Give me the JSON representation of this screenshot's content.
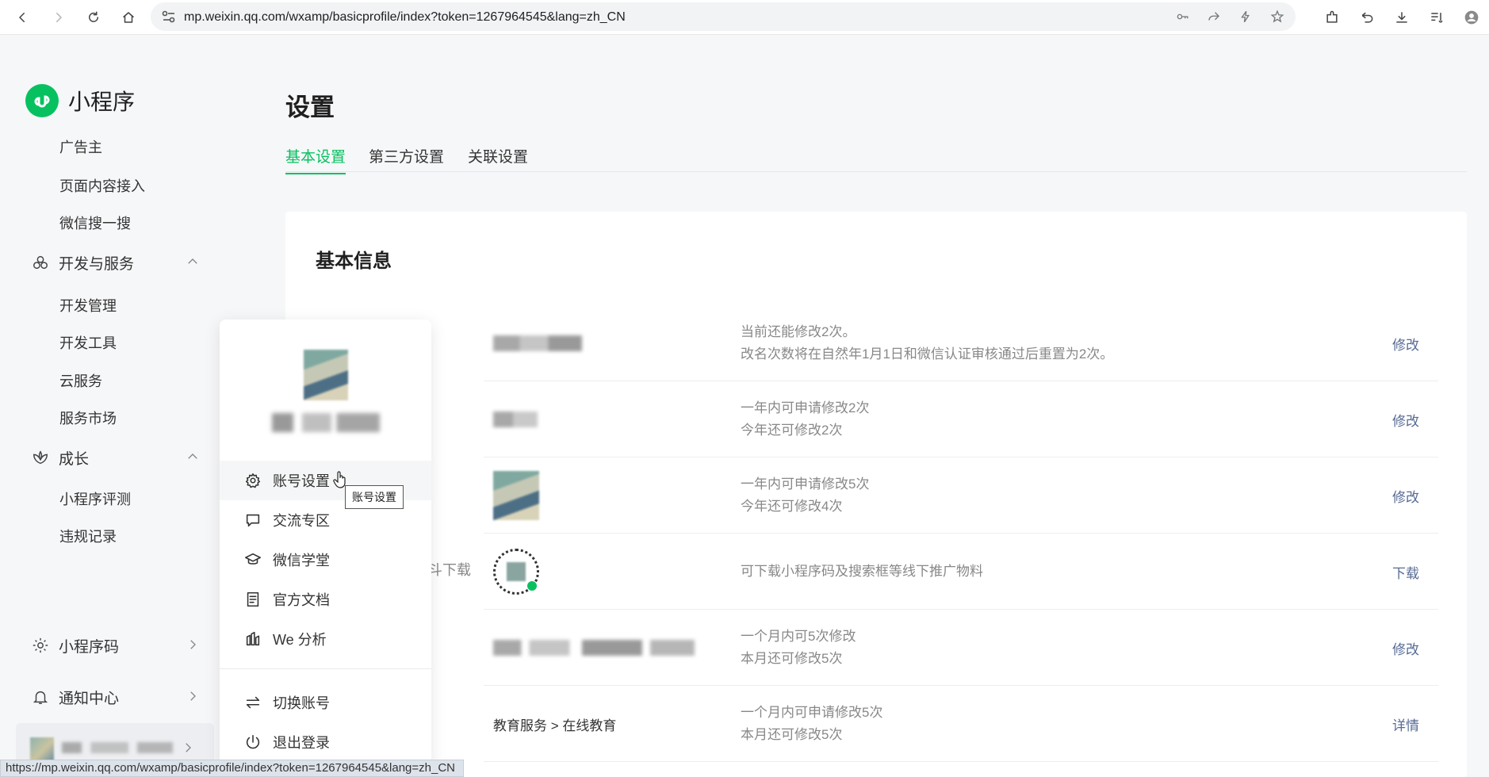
{
  "browser": {
    "url": "mp.weixin.qq.com/wxamp/basicprofile/index?token=1267964545&lang=zh_CN",
    "status_url": "https://mp.weixin.qq.com/wxamp/basicprofile/index?token=1267964545&lang=zh_CN"
  },
  "brand": {
    "name": "小程序",
    "color": "#07c160"
  },
  "sidebar": {
    "top_items": [
      "广告主",
      "页面内容接入",
      "微信搜一搜"
    ],
    "groups": [
      {
        "label": "开发与服务",
        "icon": "cluster-icon",
        "items": [
          "开发管理",
          "开发工具",
          "云服务",
          "服务市场"
        ]
      },
      {
        "label": "成长",
        "icon": "lotus-icon",
        "items": [
          "小程序评测",
          "违规记录"
        ]
      }
    ],
    "bottom_items": [
      {
        "label": "小程序码",
        "icon": "sun-icon"
      },
      {
        "label": "通知中心",
        "icon": "bell-icon"
      }
    ]
  },
  "main": {
    "title": "设置",
    "tabs": [
      {
        "label": "基本设置",
        "active": true
      },
      {
        "label": "第三方设置",
        "active": false
      },
      {
        "label": "关联设置",
        "active": false
      }
    ],
    "section_title": "基本信息",
    "partial_label": "斗下载",
    "rows": [
      {
        "value": "",
        "desc": [
          "当前还能修改2次。",
          "改名次数将在自然年1月1日和微信认证审核通过后重置为2次。"
        ],
        "action": "修改"
      },
      {
        "value": "",
        "desc": [
          "一年内可申请修改2次",
          "今年还可修改2次"
        ],
        "action": "修改"
      },
      {
        "value": "",
        "desc": [
          "一年内可申请修改5次",
          "今年还可修改4次"
        ],
        "action": "修改"
      },
      {
        "value": "",
        "desc": [
          "可下载小程序码及搜索框等线下推广物料"
        ],
        "action": "下载"
      },
      {
        "value": "",
        "desc": [
          "一个月内可5次修改",
          "本月还可修改5次"
        ],
        "action": "修改"
      },
      {
        "value": "教育服务 > 在线教育",
        "desc": [
          "一个月内可申请修改5次",
          "本月还可修改5次"
        ],
        "action": "详情"
      }
    ],
    "link_color": "#576b95"
  },
  "popup": {
    "menu": [
      {
        "label": "账号设置",
        "icon": "gear-icon"
      },
      {
        "label": "交流专区",
        "icon": "chat-icon"
      },
      {
        "label": "微信学堂",
        "icon": "graduation-cap-icon"
      },
      {
        "label": "官方文档",
        "icon": "document-icon"
      },
      {
        "label": "We 分析",
        "icon": "analytics-icon"
      }
    ],
    "menu2": [
      {
        "label": "切换账号",
        "icon": "switch-icon"
      },
      {
        "label": "退出登录",
        "icon": "power-icon"
      }
    ],
    "tooltip": "账号设置"
  }
}
